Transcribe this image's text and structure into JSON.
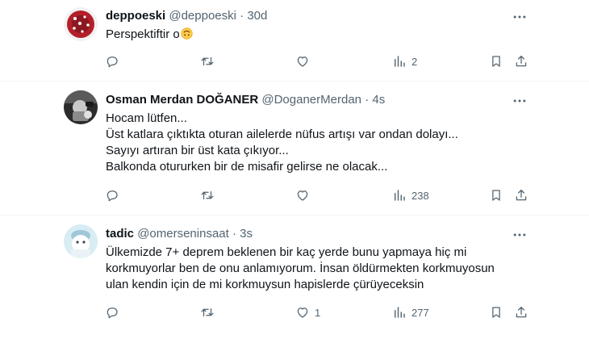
{
  "tweets": [
    {
      "name": "deppoeski",
      "handle": "@deppoeski",
      "separator": "·",
      "time": "30d",
      "lines": [
        "Perspektiftir o"
      ],
      "emoji": "upside-down-face-emoji",
      "reply_count": "",
      "retweet_count": "",
      "like_count": "",
      "view_count": "2",
      "avatar_color": "#b3202a"
    },
    {
      "name": "Osman Merdan DOĞANER",
      "handle": "@DoganerMerdan",
      "separator": "·",
      "time": "4s",
      "lines": [
        "Hocam lütfen...",
        "Üst katlara çıktıkta oturan ailelerde nüfus artışı var ondan dolayı...",
        "Sayıyı artıran bir üst kata çıkıyor...",
        "Balkonda otururken bir de misafir gelirse ne olacak..."
      ],
      "reply_count": "",
      "retweet_count": "",
      "like_count": "",
      "view_count": "238",
      "avatar_color": "#3a3a3a"
    },
    {
      "name": "tadic",
      "handle": "@omerseninsaat",
      "separator": "·",
      "time": "3s",
      "lines": [
        "Ülkemizde 7+ deprem beklenen bir kaç yerde bunu yapmaya hiç mi",
        "korkmuyorlar ben de onu anlamıyorum. İnsan öldürmekten korkmuyosun",
        "ulan kendin için de mi korkmuysun hapislerde çürüyeceksin"
      ],
      "reply_count": "",
      "retweet_count": "",
      "like_count": "1",
      "view_count": "277",
      "avatar_color": "#bcd9e6"
    }
  ],
  "icons": {
    "reply": "reply-icon",
    "retweet": "retweet-icon",
    "like": "like-icon",
    "views": "views-icon",
    "share": "share-icon",
    "more": "more-icon"
  },
  "colors": {
    "text": "#0f1419",
    "secondary": "#536471",
    "divider": "#eff3f4"
  }
}
